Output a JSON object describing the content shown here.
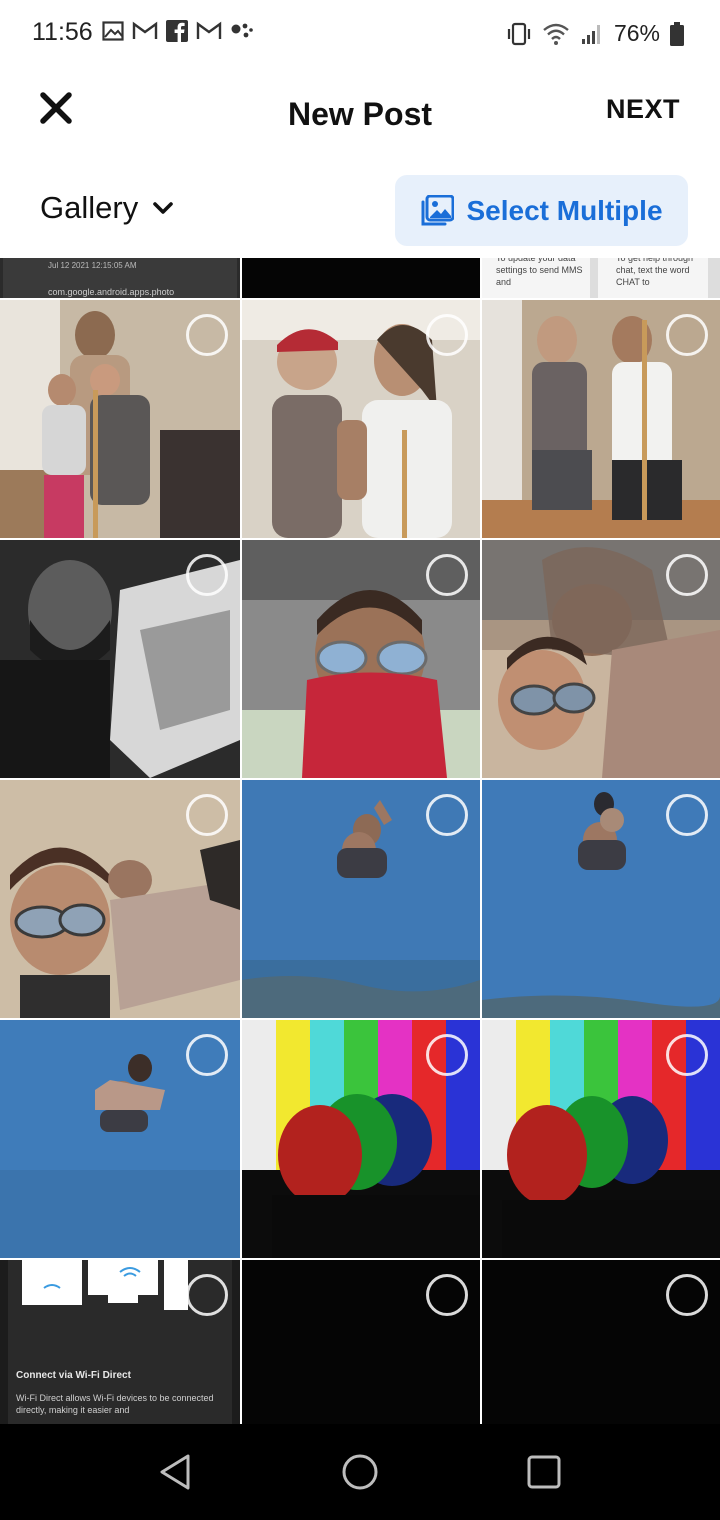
{
  "status_bar": {
    "time": "11:56",
    "battery_percent": "76%",
    "left_icons": [
      "gallery-notification-icon",
      "gmail-icon",
      "facebook-icon",
      "gmail-icon",
      "more-notifications-icon"
    ],
    "right_icons": [
      "vibrate-icon",
      "wifi-icon",
      "signal-icon",
      "battery-icon"
    ]
  },
  "header": {
    "title": "New Post",
    "next_label": "NEXT",
    "close_icon": "close-icon"
  },
  "toolbar": {
    "album_label": "Gallery",
    "select_multiple_label": "Select Multiple",
    "accent_color": "#1a6ed8"
  },
  "grid": {
    "partial_row": {
      "tile_1_caption_date": "Jul 12 2021 12:15:05 AM",
      "tile_1_caption_text": "com.google.android.apps.photo",
      "tile_3_text": "To update your data settings to send MMS and",
      "tile_4_text": "To get help through chat, text the word CHAT to"
    },
    "wifi_direct_tile": {
      "heading": "Connect via Wi-Fi Direct",
      "body": "Wi-Fi Direct allows Wi-Fi devices to be connected directly, making it easier and"
    }
  },
  "nav_bar": {
    "back_icon": "back-triangle-icon",
    "home_icon": "home-circle-icon",
    "recents_icon": "recents-square-icon"
  }
}
